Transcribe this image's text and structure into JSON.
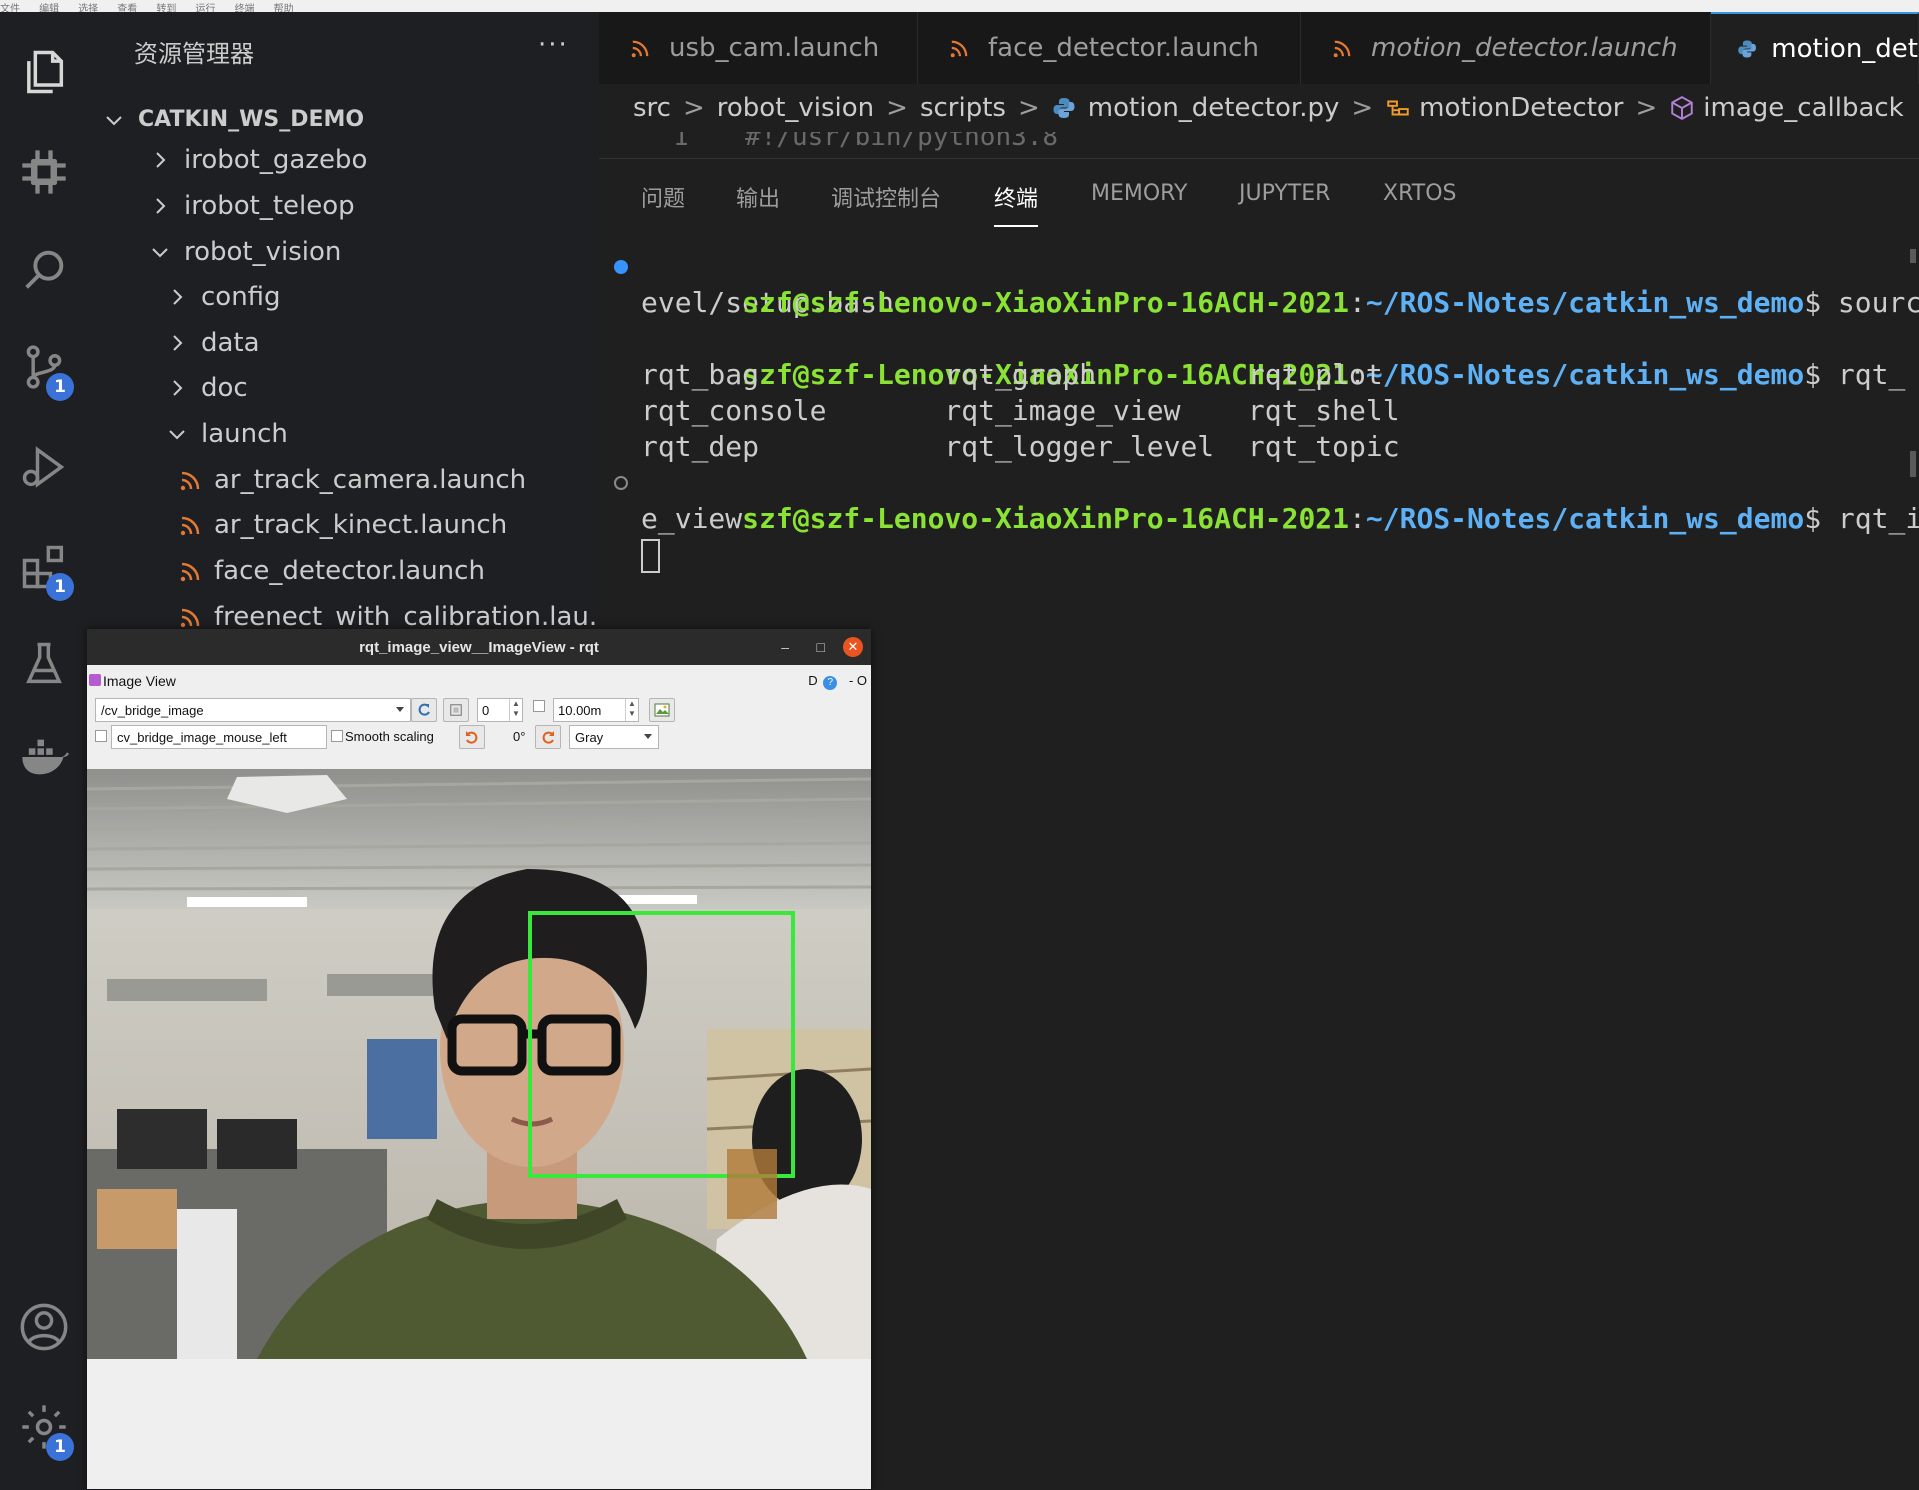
{
  "menubar": [
    "文件",
    "编辑",
    "选择",
    "查看",
    "转到",
    "运行",
    "终端",
    "帮助"
  ],
  "activity_badges": {
    "scm": "1",
    "extensions": "1",
    "settings": "1"
  },
  "sidebar": {
    "title": "资源管理器",
    "more": "···",
    "root": "CATKIN_WS_DEMO",
    "items": [
      {
        "label": "irobot_gazebo"
      },
      {
        "label": "irobot_teleop"
      },
      {
        "label": "robot_vision"
      },
      {
        "label": "config"
      },
      {
        "label": "data"
      },
      {
        "label": "doc"
      },
      {
        "label": "launch"
      },
      {
        "label": "ar_track_camera.launch"
      },
      {
        "label": "ar_track_kinect.launch"
      },
      {
        "label": "face_detector.launch"
      },
      {
        "label": "freenect_with_calibration.lau..."
      }
    ]
  },
  "tabs": [
    {
      "label": "usb_cam.launch"
    },
    {
      "label": "face_detector.launch"
    },
    {
      "label": "motion_detector.launch"
    },
    {
      "label": "motion_det"
    }
  ],
  "breadcrumb": {
    "parts": [
      "src",
      "robot_vision",
      "scripts",
      "motion_detector.py",
      "motionDetector",
      "image_callback"
    ]
  },
  "code": {
    "line_number": "1",
    "text": "#!/usr/bin/python3.8"
  },
  "panel_tabs": [
    "问题",
    "输出",
    "调试控制台",
    "终端",
    "MEMORY",
    "JUPYTER",
    "XRTOS"
  ],
  "terminal": {
    "user": "szf@szf-Lenovo-XiaoXinPro-16ACH-2021",
    "sep": ":",
    "path": "~/ROS-Notes/catkin_ws_demo",
    "dollar": "$",
    "cmd1_a": " source d",
    "cmd1_b": "evel/setup.bash",
    "cmd2": " rqt_",
    "completions": [
      "rqt_bag           rqt_graph         rqt_plot",
      "rqt_console       rqt_image_view    rqt_shell",
      "rqt_dep           rqt_logger_level  rqt_topic"
    ],
    "cmd3_a": " rqt_imag",
    "cmd3_b": "e_view"
  },
  "rqt": {
    "title": "rqt_image_view__ImageView - rqt",
    "min": "–",
    "max": "□",
    "close": "✕",
    "plugin_label": "Image View",
    "plugin_right": "D",
    "plugin_right2": "- O",
    "topic": "/cv_bridge_image",
    "spin_value": "0",
    "rate": "10.00m",
    "mouse_topic": "cv_bridge_image_mouse_left",
    "smooth_scaling": "Smooth scaling",
    "rotation": "0°",
    "colormap": "Gray"
  },
  "colors": {
    "accent": "#3a96dd",
    "prompt_user": "#8ae234",
    "prompt_path": "#5eb1f5",
    "rss": "#e37933",
    "face_box": "#39e83d"
  }
}
